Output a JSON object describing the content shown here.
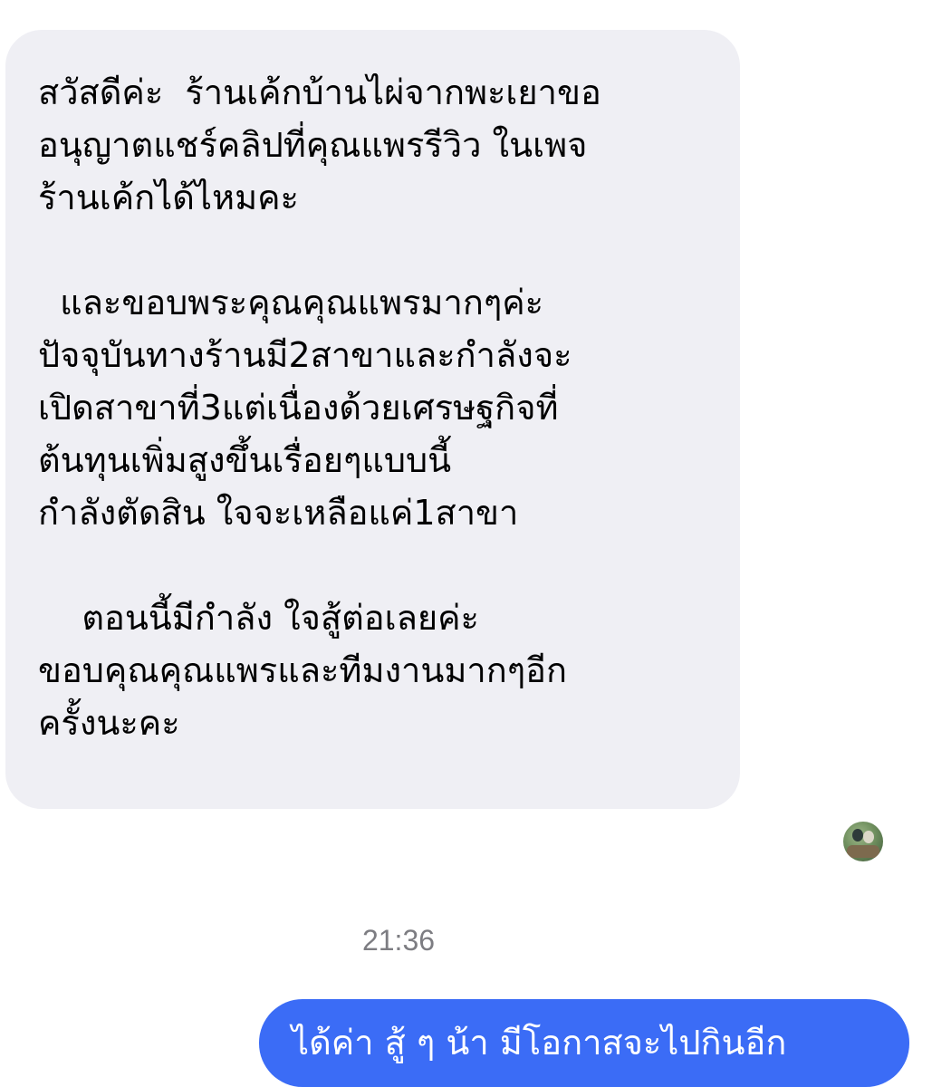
{
  "conversation": {
    "incoming_message": {
      "lines": [
        "สวัสดีค่ะ  ร้านเค้กบ้านไผ่จากพะเยาขอ",
        "อนุญาตแชร์คลิปที่คุณแพรรีวิว ในเพจ",
        "ร้านเค้กได้ไหมคะ",
        "",
        "  และขอบพระคุณคุณแพรมากๆค่ะ",
        "ปัจจุบันทางร้านมี2สาขาและกำลังจะ",
        "เปิดสาขาที่3แต่เนื่องด้วยเศรษฐกิจที่",
        "ต้นทุนเพิ่มสูงขึ้นเรื่อยๆแบบนี้",
        "กำลังตัดสิน ใจจะเหลือแค่1สาขา",
        "",
        "    ตอนนี้มีกำลัง ใจสู้ต่อเลยค่ะ",
        "ขอบคุณคุณแพรและทีมงานมากๆอีก",
        "ครั้งนะคะ"
      ],
      "bubble_color": "#efeff4"
    },
    "timestamp": "21:36",
    "outgoing_message": {
      "text": "ได้ค่า สู้ ๆ น้า มีโอกาสจะไปกินอีก",
      "bubble_color": "#3b6cf6"
    },
    "avatar_icon": "user-avatar-photo"
  }
}
